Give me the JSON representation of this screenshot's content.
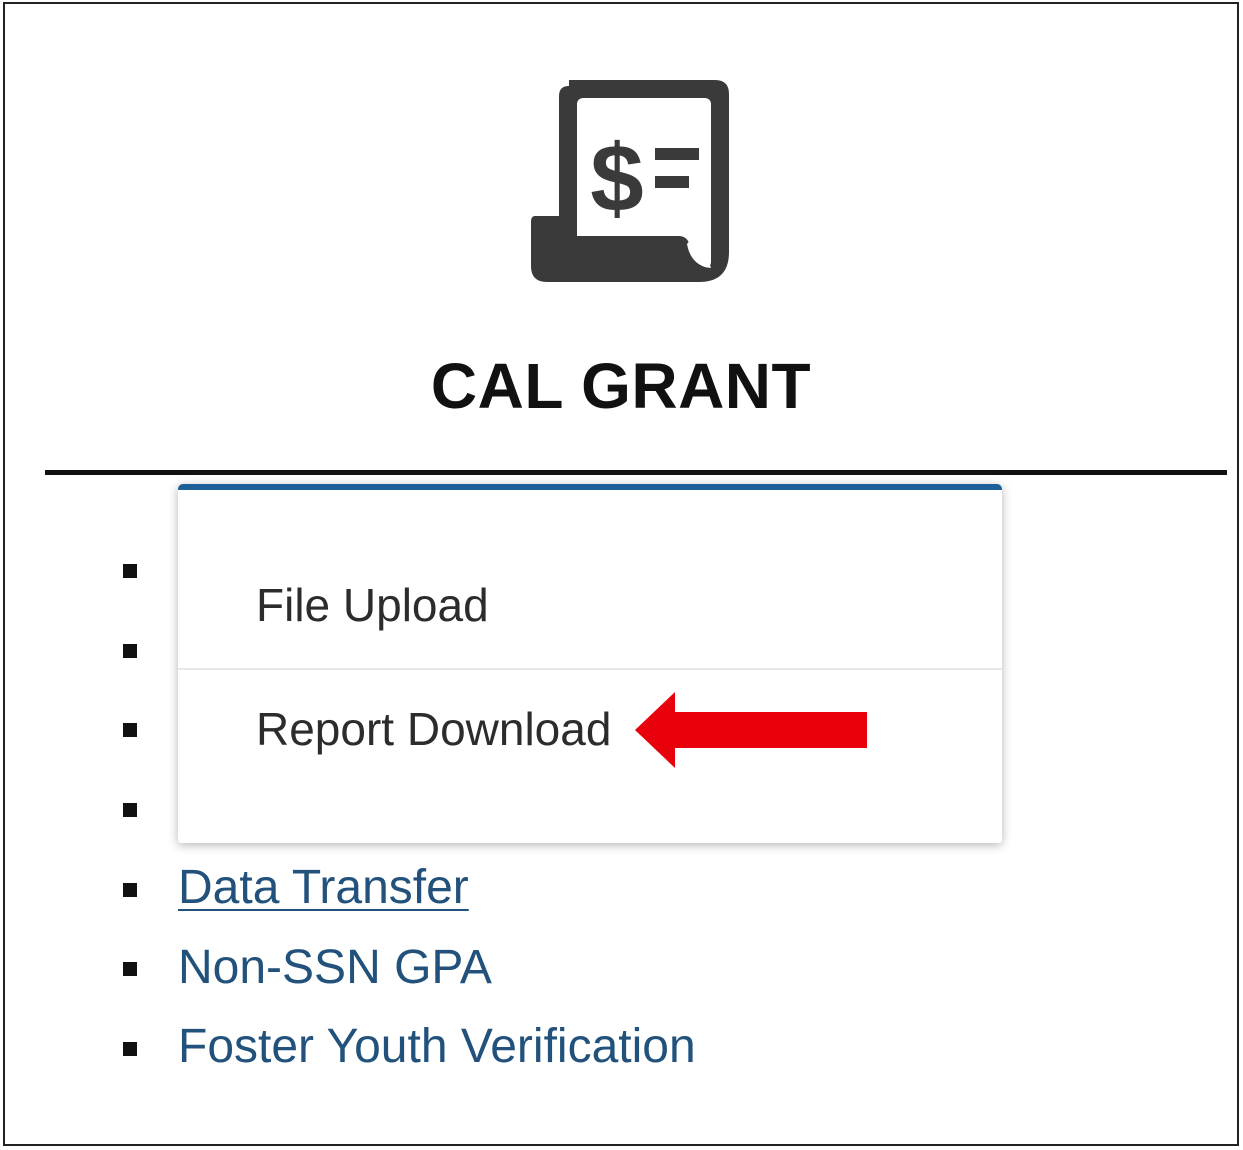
{
  "header": {
    "icon": "dollar-scroll-icon",
    "title": "CAL GRANT"
  },
  "dropdown": {
    "items": [
      {
        "label": "File Upload"
      },
      {
        "label": "Report Download"
      }
    ]
  },
  "menu": {
    "items": [
      {
        "label": "Data Transfer",
        "underlined": true
      },
      {
        "label": "Non-SSN GPA"
      },
      {
        "label": "Foster Youth Verification"
      }
    ]
  },
  "annotation": {
    "arrow_color": "#e8000b",
    "points_to": "Report Download"
  },
  "colors": {
    "link": "#22527c",
    "dropdown_accent": "#1f5f99",
    "icon": "#3a3a3a"
  }
}
